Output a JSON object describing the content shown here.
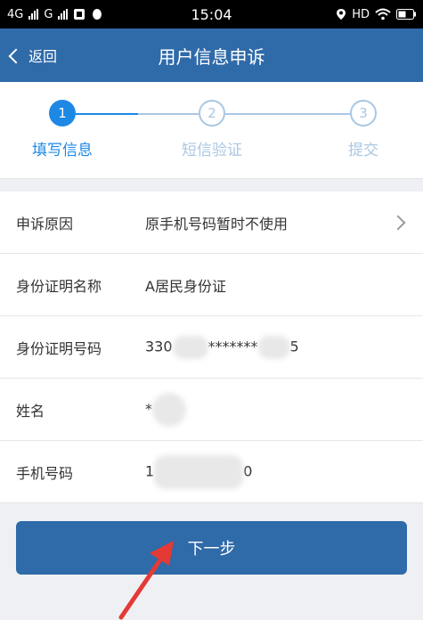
{
  "status_bar": {
    "net1": "4G",
    "net2": "G",
    "time": "15:04",
    "hd": "HD"
  },
  "nav": {
    "back_label": "返回",
    "title": "用户信息申诉"
  },
  "steps": [
    {
      "number": "1",
      "label": "填写信息",
      "active": true
    },
    {
      "number": "2",
      "label": "短信验证",
      "active": false
    },
    {
      "number": "3",
      "label": "提交",
      "active": false
    }
  ],
  "form": {
    "reason_label": "申诉原因",
    "reason_value": "原手机号码暂时不使用",
    "id_name_label": "身份证明名称",
    "id_name_value": "A居民身份证",
    "id_number_label": "身份证明号码",
    "id_number_prefix": "330",
    "id_number_middle": "*******",
    "id_number_suffix": "5",
    "name_label": "姓名",
    "name_value": "*",
    "phone_label": "手机号码",
    "phone_prefix": "1",
    "phone_suffix": "0"
  },
  "next_button": "下一步",
  "colors": {
    "brand": "#2f6aa9",
    "step_active": "#1e88e5",
    "step_inactive": "#a9c7e2",
    "annotation_arrow": "#e53935"
  },
  "icons": {
    "back": "chevron-left-icon",
    "row_more": "chevron-right-icon",
    "annotation": "red-arrow-icon"
  }
}
